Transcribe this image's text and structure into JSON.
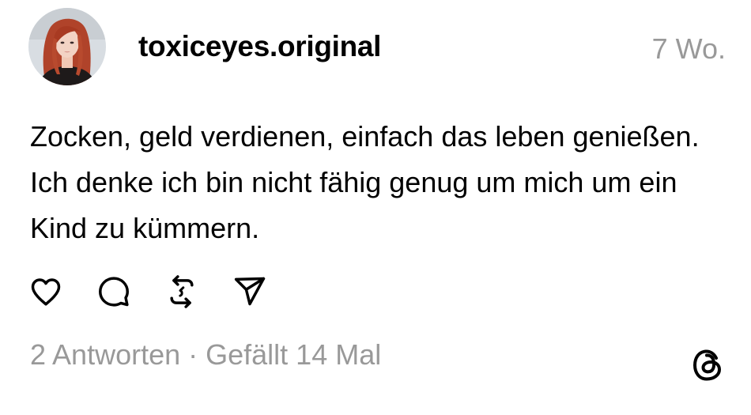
{
  "post": {
    "username": "toxiceyes.original",
    "timestamp": "7 Wo.",
    "text": "Zocken, geld verdienen, einfach das leben genießen. Ich denke ich bin nicht fähig genug um mich um ein Kind zu kümmern.",
    "replies_label": "2 Antworten",
    "separator": " · ",
    "likes_label": "Gefällt 14 Mal"
  },
  "actions": [
    {
      "icon": "heart-icon"
    },
    {
      "icon": "comment-icon"
    },
    {
      "icon": "repost-icon"
    },
    {
      "icon": "share-icon"
    }
  ],
  "brand": {
    "icon": "threads-logo-icon"
  },
  "colors": {
    "text": "#000000",
    "muted": "#999999",
    "background": "#ffffff"
  }
}
